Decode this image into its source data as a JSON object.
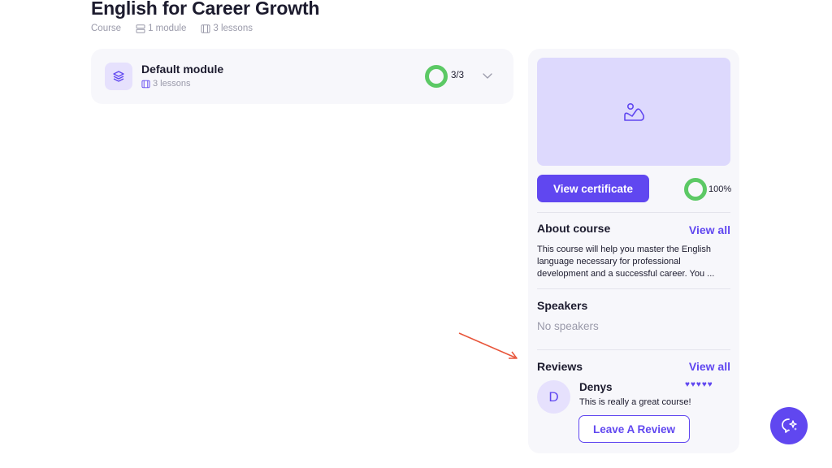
{
  "course": {
    "title": "English for Career Growth",
    "type_label": "Course",
    "modules_count": "1 module",
    "lessons_count": "3 lessons"
  },
  "module": {
    "title": "Default module",
    "lessons": "3 lessons",
    "progress_text": "3/3",
    "icon": "layers-icon"
  },
  "sidebar": {
    "cover_icon": "image-placeholder-icon",
    "certificate_button": "View certificate",
    "progress_percent": "100%",
    "about": {
      "title": "About course",
      "view_all": "View all",
      "text": "This course will help you master the English language necessary for professional development and a successful career. You ..."
    },
    "speakers": {
      "title": "Speakers",
      "empty": "No speakers"
    },
    "reviews": {
      "title": "Reviews",
      "view_all": "View all",
      "items": [
        {
          "initial": "D",
          "name": "Denys",
          "text": "This is really a great course!",
          "rating": 5
        }
      ],
      "leave_button": "Leave A Review"
    }
  },
  "colors": {
    "accent": "#6047f0",
    "progress": "#5cc965",
    "annotation_arrow": "#e8553a"
  },
  "fab": {
    "icon": "ai-assistant-icon"
  }
}
